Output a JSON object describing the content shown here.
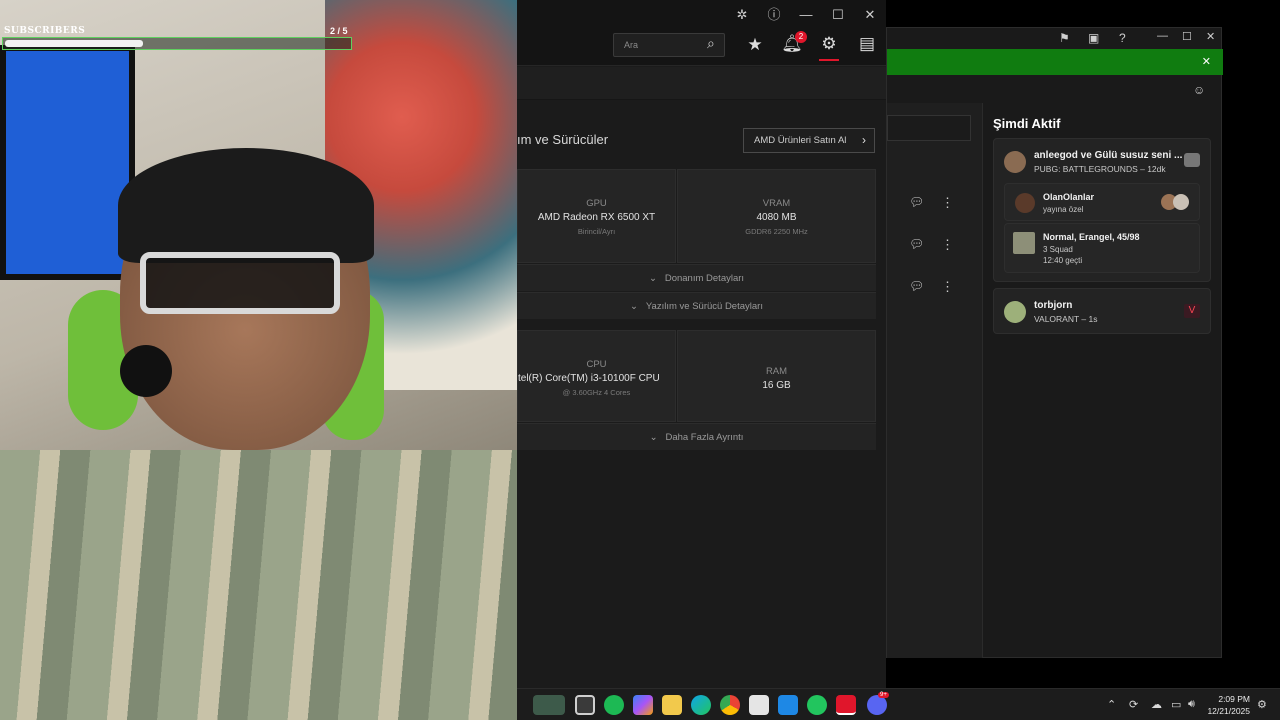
{
  "overlay": {
    "subscribers_label": "SUBSCRIBERS",
    "subscribers_count": "2 / 5",
    "subscribers_progress": 0.4
  },
  "amd": {
    "search_placeholder": "Ara",
    "notification_count": "2",
    "heading_partial": "ım ve Sürücüler",
    "buy_button": "AMD Ürünleri Satın Al",
    "gpu": {
      "label": "GPU",
      "value": "AMD Radeon RX 6500 XT",
      "sub": "Birincil/Ayrı"
    },
    "vram": {
      "label": "VRAM",
      "value": "4080 MB",
      "sub": "GDDR6 2250 MHz"
    },
    "hardware_details": "Donanım Detayları",
    "software_details": "Yazılım ve Sürücü Detayları",
    "cpu": {
      "label": "CPU",
      "value": "tel(R) Core(TM) i3-10100F CPU",
      "sub": "@ 3.60GHz 4 Cores"
    },
    "ram": {
      "label": "RAM",
      "value": "16 GB"
    },
    "more_details": "Daha Fazla Ayrıntı"
  },
  "xbox": {
    "now_active": "Şimdi Aktif",
    "friends": [
      {
        "name": "anleegod ve Gülü susuz seni ...",
        "status": "PUBG: BATTLEGROUNDS – 12dk"
      },
      {
        "name": "OlanOlanlar",
        "status": "yayına özel"
      },
      {
        "name": "Normal, Erangel, 45/98",
        "status": "3 Squad",
        "status2": "12:40 geçti"
      },
      {
        "name": "torbjorn",
        "status": "VALORANT – 1s"
      }
    ]
  },
  "taskbar": {
    "clock_time": "2:09 PM",
    "clock_date": "12/21/2025",
    "discord_badge": "9+"
  }
}
